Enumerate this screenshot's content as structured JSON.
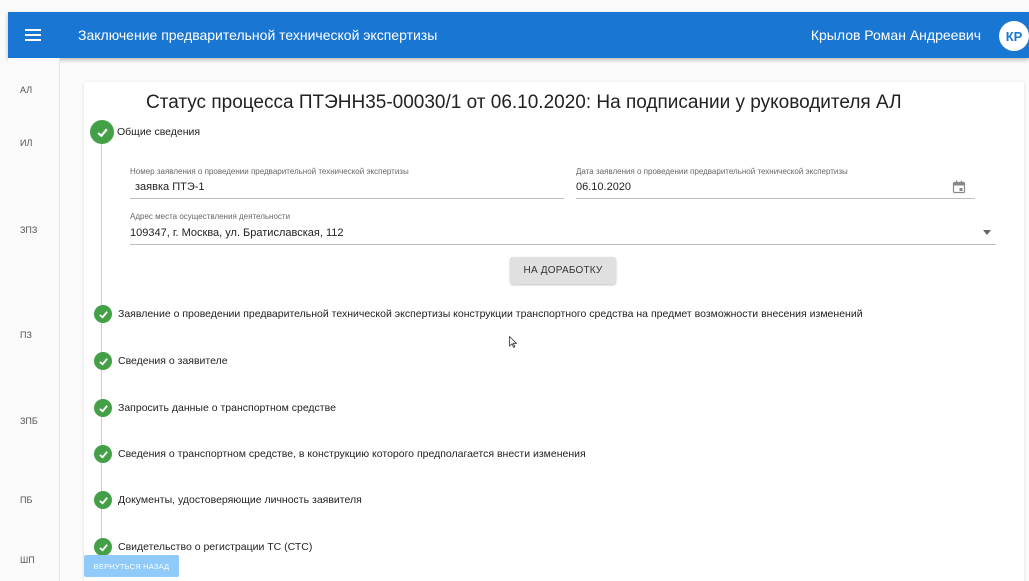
{
  "header": {
    "title": "Заключение предварительной технической экспертизы",
    "user_name": "Крылов Роман Андреевич",
    "avatar_initials": "КР",
    "color": "#1976d2"
  },
  "sidebar": {
    "items": [
      {
        "label": "АЛ"
      },
      {
        "label": "ИЛ"
      },
      {
        "label": "ЗПЗ"
      },
      {
        "label": "ПЗ"
      },
      {
        "label": "ЗПБ"
      },
      {
        "label": "ПБ"
      },
      {
        "label": "ШП"
      }
    ]
  },
  "main": {
    "status_title": "Статус процесса ПТЭНН35-00030/1 от 06.10.2020: На подписании у руководителя АЛ",
    "steps": [
      {
        "label": "Общие сведения",
        "done": true
      },
      {
        "label": "Заявление о проведении предварительной технической экспертизы конструкции транспортного средства на предмет возможности внесения изменений",
        "done": true
      },
      {
        "label": "Сведения о заявителе",
        "done": true
      },
      {
        "label": "Запросить данные о транспортном средстве",
        "done": true
      },
      {
        "label": "Сведения о транспортном средстве, в конструкцию которого предполагается внести изменения",
        "done": true
      },
      {
        "label": "Документы, удостоверяющие личность заявителя",
        "done": true
      },
      {
        "label": "Свидетельство о регистрации ТС (СТС)",
        "done": true
      }
    ],
    "form": {
      "application_number": {
        "label": "Номер заявления о проведении предварительной технической экспертизы",
        "value": "заявка ПТЭ-1"
      },
      "application_date": {
        "label": "Дата заявления о проведении предварительной технической экспертизы",
        "value": "06.10.2020"
      },
      "address": {
        "label": "Адрес места осуществления деятельности",
        "value": "109347, г. Москва, ул. Братиславская, 112"
      }
    },
    "rework_button": "НА ДОРАБОТКУ",
    "back_button": "ВЕРНУТЬСЯ НАЗАД",
    "success_color": "#43a047"
  }
}
